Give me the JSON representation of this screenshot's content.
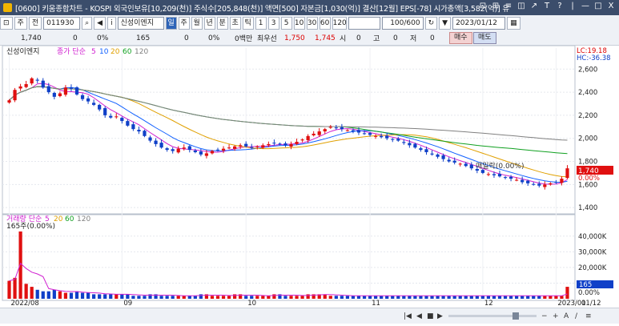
{
  "window": {
    "title": "[0600] 키움종합차트 - KOSPI 외국인보유[10,209(천)] 주식수[205,848(천)] 액면[500] 자본금[1,030(억)] 결산[12월] EPS[-78] 시가총액[3,582(억)] 유",
    "controls": [
      "⊡",
      "⊞",
      "≡",
      "◫",
      "↗",
      "T",
      "?",
      "|",
      "—",
      "□",
      "X"
    ]
  },
  "toolbar": {
    "stock_code": "011930",
    "stock_name": "신성이엔지",
    "prefix_buttons": [
      "주",
      "전"
    ],
    "period_buttons": [
      "일",
      "주",
      "월",
      "년",
      "분",
      "초",
      "틱"
    ],
    "active_period": "일",
    "minute_buttons": [
      "1",
      "3",
      "5",
      "10",
      "30",
      "60",
      "120"
    ],
    "count": "100/600",
    "date": "2023/01/12"
  },
  "quote": {
    "price": "1,740",
    "change": "0",
    "change_pct": "0%",
    "volume": "165",
    "vol_change": "0",
    "vol_pct": "0%",
    "amount": "0백만",
    "best_label": "최우선",
    "ask": "1,750",
    "bid": "1,745",
    "open_label": "시",
    "open": "0",
    "high_label": "고",
    "high": "0",
    "low_label": "저",
    "low": "0",
    "buy": "매수",
    "sell": "매도"
  },
  "price_panel": {
    "stock_label": "신성이엔지",
    "ma_label": "종가 단순",
    "ma_periods": [
      "5",
      "10",
      "20",
      "60",
      "120"
    ],
    "lc": "LC:19.18",
    "hc": "HC:-36.38",
    "yticks": [
      "2,600",
      "2,400",
      "2,200",
      "2,000",
      "1,800",
      "1,600",
      "1,400"
    ],
    "last_price_tag": "1,740",
    "last_pct_tag": "0.00%",
    "annotation": "매일락(0.00%)"
  },
  "volume_panel": {
    "label": "거래량 단순",
    "ma_periods": [
      "5",
      "20",
      "60",
      "120"
    ],
    "sub_label": "165주(0.00%)",
    "yticks": [
      "40,000K",
      "30,000K",
      "20,000K",
      "10,000K",
      "0.00%"
    ],
    "last_tag": "165",
    "zero_tag": "0.00%"
  },
  "xaxis": {
    "labels": [
      "2022/08",
      "09",
      "10",
      "11",
      "12",
      "2023/01"
    ],
    "right_label": "01/12"
  },
  "chart_data": {
    "type": "candlestick",
    "ylim": [
      1380,
      2720
    ],
    "close_trend": [
      2330,
      2420,
      2450,
      2470,
      2520,
      2500,
      2440,
      2400,
      2360,
      2390,
      2440,
      2430,
      2380,
      2340,
      2320,
      2290,
      2250,
      2200,
      2180,
      2190,
      2150,
      2110,
      2080,
      2060,
      2020,
      1980,
      1950,
      1920,
      1900,
      1890,
      1910,
      1920,
      1900,
      1880,
      1860,
      1870,
      1890,
      1900,
      1910,
      1920,
      1930,
      1940,
      1930,
      1920,
      1930,
      1940,
      1950,
      1960,
      1950,
      1940,
      1950,
      1970,
      1990,
      2020,
      2040,
      2060,
      2080,
      2100,
      2090,
      2080,
      2070,
      2060,
      2050,
      2040,
      2030,
      2020,
      2010,
      2000,
      1990,
      1980,
      1960,
      1940,
      1920,
      1900,
      1880,
      1860,
      1840,
      1820,
      1800,
      1790,
      1780,
      1760,
      1740,
      1720,
      1700,
      1690,
      1680,
      1670,
      1660,
      1650,
      1640,
      1620,
      1610,
      1600,
      1590,
      1600,
      1610,
      1620,
      1650,
      1740
    ],
    "volume_trend": [
      12,
      14,
      45,
      10,
      8,
      6,
      5,
      5,
      6,
      5,
      4,
      4,
      5,
      4,
      4,
      3,
      3,
      3,
      3,
      3,
      3,
      3,
      2,
      2,
      2,
      3,
      3,
      2,
      2,
      2,
      2,
      2,
      2,
      2,
      3,
      3,
      2,
      2,
      2,
      2,
      3,
      3,
      2,
      2,
      2,
      2,
      2,
      3,
      3,
      2,
      2,
      2,
      2,
      3,
      3,
      3,
      3,
      2,
      2,
      2,
      2,
      2,
      2,
      2,
      2,
      2,
      2,
      2,
      2,
      2,
      2,
      2,
      2,
      2,
      2,
      2,
      2,
      2,
      2,
      2,
      2,
      2,
      2,
      2,
      2,
      2,
      2,
      2,
      2,
      2,
      2,
      2,
      2,
      2,
      2,
      2,
      2,
      2,
      2,
      8
    ]
  },
  "colors": {
    "up": "#e01010",
    "down": "#1040c8",
    "ma5": "#d020d0",
    "ma10": "#1060ff",
    "ma20": "#e0a000",
    "ma60": "#10a020",
    "ma120": "#808080",
    "title_bg": "#3b4d6b",
    "accent": "#2e64b8"
  }
}
